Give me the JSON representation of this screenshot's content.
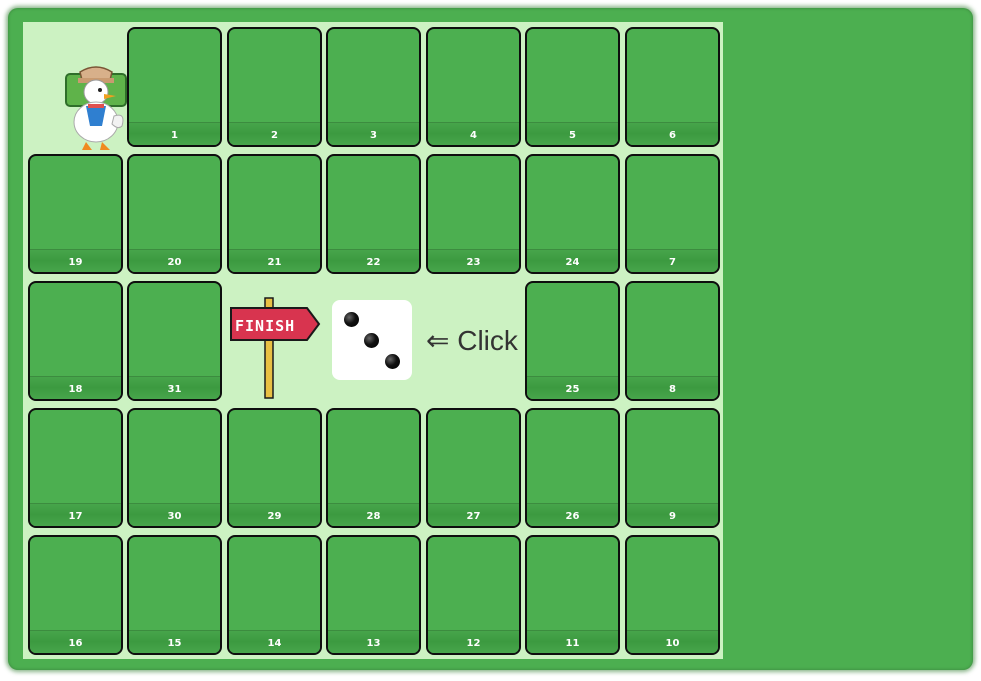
{
  "board": {
    "cells": [
      {
        "n": "1",
        "c": 1,
        "r": 0
      },
      {
        "n": "2",
        "c": 2,
        "r": 0
      },
      {
        "n": "3",
        "c": 3,
        "r": 0
      },
      {
        "n": "4",
        "c": 4,
        "r": 0
      },
      {
        "n": "5",
        "c": 5,
        "r": 0
      },
      {
        "n": "6",
        "c": 6,
        "r": 0
      },
      {
        "n": "19",
        "c": 0,
        "r": 1
      },
      {
        "n": "20",
        "c": 1,
        "r": 1
      },
      {
        "n": "21",
        "c": 2,
        "r": 1
      },
      {
        "n": "22",
        "c": 3,
        "r": 1
      },
      {
        "n": "23",
        "c": 4,
        "r": 1
      },
      {
        "n": "24",
        "c": 5,
        "r": 1
      },
      {
        "n": "7",
        "c": 6,
        "r": 1
      },
      {
        "n": "18",
        "c": 0,
        "r": 2
      },
      {
        "n": "31",
        "c": 1,
        "r": 2
      },
      {
        "n": "25",
        "c": 5,
        "r": 2
      },
      {
        "n": "8",
        "c": 6,
        "r": 2
      },
      {
        "n": "17",
        "c": 0,
        "r": 3
      },
      {
        "n": "30",
        "c": 1,
        "r": 3
      },
      {
        "n": "29",
        "c": 2,
        "r": 3
      },
      {
        "n": "28",
        "c": 3,
        "r": 3
      },
      {
        "n": "27",
        "c": 4,
        "r": 3
      },
      {
        "n": "26",
        "c": 5,
        "r": 3
      },
      {
        "n": "9",
        "c": 6,
        "r": 3
      },
      {
        "n": "16",
        "c": 0,
        "r": 4
      },
      {
        "n": "15",
        "c": 1,
        "r": 4
      },
      {
        "n": "14",
        "c": 2,
        "r": 4
      },
      {
        "n": "13",
        "c": 3,
        "r": 4
      },
      {
        "n": "12",
        "c": 4,
        "r": 4
      },
      {
        "n": "11",
        "c": 5,
        "r": 4
      },
      {
        "n": "10",
        "c": 6,
        "r": 4
      }
    ]
  },
  "finish_sign": {
    "text": "FINISH"
  },
  "dice": {
    "value": 3
  },
  "click_hint": "⇐ Click",
  "colors": {
    "frame": "#4caf50",
    "board": "#ccf2c2",
    "cell": "#4caf50",
    "sign": "#d8344f",
    "pole": "#e8c043"
  },
  "icons": {
    "character": "duck-detective-icon",
    "finish": "finish-signpost-icon",
    "dice": "dice-icon"
  }
}
